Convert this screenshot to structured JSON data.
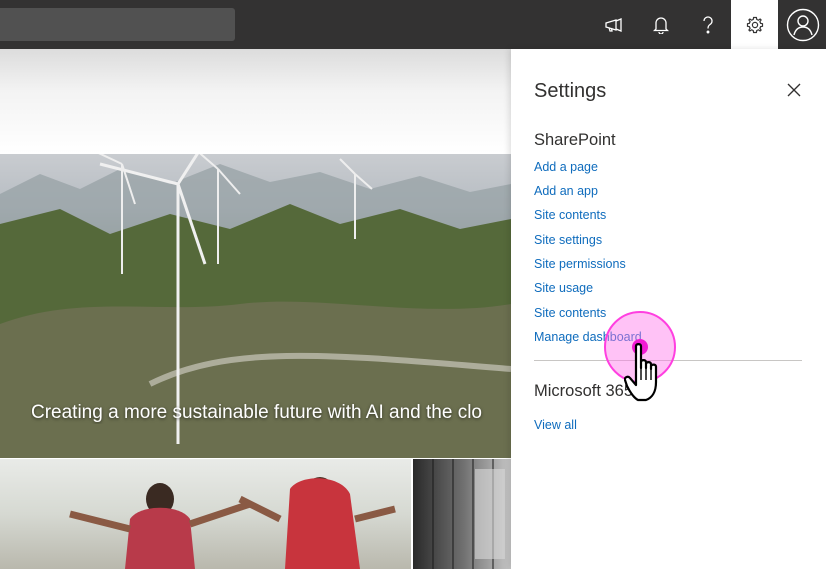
{
  "topbar": {
    "icons": [
      "feedback-megaphone-icon",
      "notification-bell-icon",
      "help-icon",
      "settings-gear-icon",
      "user-avatar-icon"
    ],
    "active_icon": "settings-gear-icon",
    "background": "#333232"
  },
  "hero": {
    "caption": "Creating a more sustainable future with AI and the clo"
  },
  "settings": {
    "title": "Settings",
    "sharepoint": {
      "title": "SharePoint",
      "links": [
        "Add a page",
        "Add an app",
        "Site contents",
        "Site settings",
        "Site permissions",
        "Site usage",
        "Site contents",
        "Manage dashboard"
      ]
    },
    "microsoft365": {
      "title": "Microsoft 365",
      "links": [
        "View all"
      ]
    }
  },
  "colors": {
    "link": "#0f6cbd",
    "click_highlight": "#ff3fe0"
  }
}
